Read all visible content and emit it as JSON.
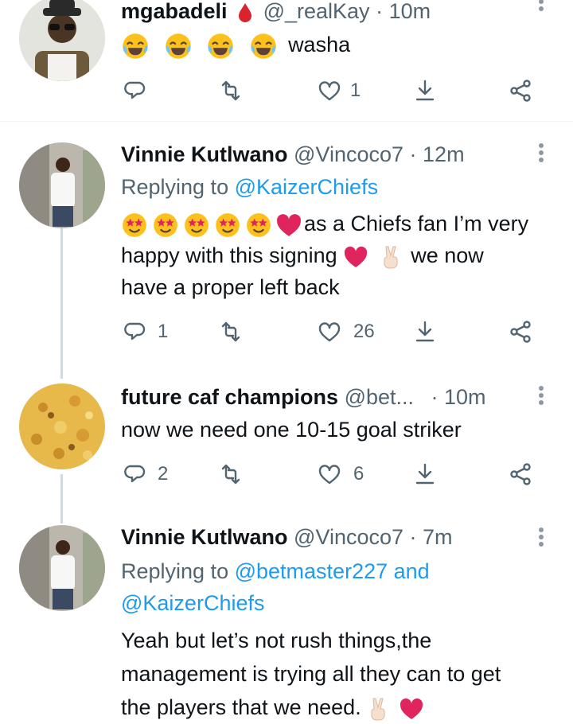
{
  "tweets": [
    {
      "name": "mgabadeli",
      "handle": "@_realKay",
      "time": "· 10m",
      "body_text": "washa",
      "counts": {
        "reply": "",
        "retweet": "",
        "like": "1",
        "share": ""
      }
    },
    {
      "name": "Vinnie Kutlwano",
      "handle": "@Vincoco7",
      "time": "· 12m",
      "replying_prefix": "Replying to",
      "replying_to": "@KaizerChiefs",
      "body_line1": "as a Chiefs fan I’m very",
      "body_line2a": "happy with this signing",
      "body_line2b": "we now",
      "body_line3": "have a proper left back",
      "counts": {
        "reply": "1",
        "retweet": "",
        "like": "26",
        "share": ""
      }
    },
    {
      "name": "future caf champions",
      "handle": "@bet...",
      "time": "· 10m",
      "body_text": "now we need one 10-15 goal striker",
      "counts": {
        "reply": "2",
        "retweet": "",
        "like": "6",
        "share": ""
      }
    },
    {
      "name": "Vinnie Kutlwano",
      "handle": "@Vincoco7",
      "time": "· 7m",
      "replying_prefix": "Replying to",
      "replying_to_1": "@betmaster227",
      "replying_and": "and",
      "replying_to_2": "@KaizerChiefs",
      "body_line1": "Yeah but let’s not rush things,the",
      "body_line2": "management is trying all they can to get",
      "body_line3": "the players that we need.",
      "counts": {
        "reply": "",
        "retweet": "",
        "like": "",
        "share": ""
      }
    }
  ],
  "colors": {
    "accent": "#1d9bf0",
    "secondary_text": "#536471",
    "heart": "#e0245e",
    "thread_line": "#cfd9de"
  },
  "icons": [
    "reply-icon",
    "retweet-icon",
    "like-icon",
    "share-icon",
    "more-icon",
    "drop-icon",
    "laugh-emoji",
    "starstruck-emoji",
    "heart-emoji",
    "victory-emoji"
  ]
}
